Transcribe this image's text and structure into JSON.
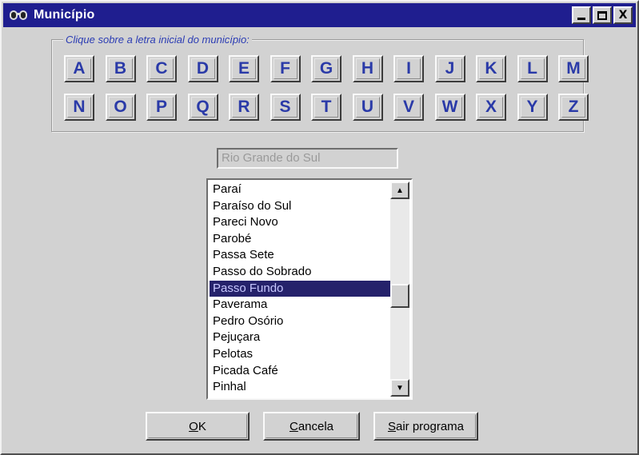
{
  "window": {
    "title": "Município",
    "minimize_symbol": "_",
    "maximize_symbol": "□",
    "close_symbol": "X"
  },
  "letters": {
    "label": "Clique sobre a letra inicial do município:",
    "row1": [
      "A",
      "B",
      "C",
      "D",
      "E",
      "F",
      "G",
      "H",
      "I",
      "J",
      "K",
      "L",
      "M"
    ],
    "row2": [
      "N",
      "O",
      "P",
      "Q",
      "R",
      "S",
      "T",
      "U",
      "V",
      "W",
      "X",
      "Y",
      "Z"
    ]
  },
  "state_field": {
    "value": "Rio Grande do Sul"
  },
  "municipios": {
    "items": [
      "Paraí",
      "Paraíso do Sul",
      "Pareci Novo",
      "Parobé",
      "Passa Sete",
      "Passo do Sobrado",
      "Passo Fundo",
      "Paverama",
      "Pedro Osório",
      "Pejuçara",
      "Pelotas",
      "Picada Café",
      "Pinhal"
    ],
    "selected": "Passo Fundo",
    "scroll_up_icon": "▲",
    "scroll_down_icon": "▼"
  },
  "buttons": {
    "ok": {
      "hotkey": "O",
      "rest": "K"
    },
    "cancela": {
      "hotkey": "C",
      "rest": "ancela"
    },
    "sair": {
      "hotkey": "S",
      "rest": "air programa"
    }
  },
  "icons": {
    "title_icon": "binoculars-icon"
  }
}
